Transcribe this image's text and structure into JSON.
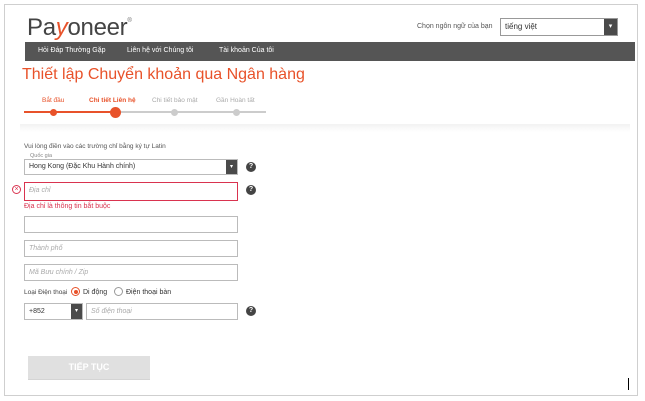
{
  "header": {
    "logo_pre": "Pa",
    "logo_y": "y",
    "logo_post": "oneer",
    "logo_mark": "®",
    "language_label": "Chọn ngôn ngữ của bạn",
    "language_value": "tiếng việt"
  },
  "nav": {
    "items": [
      "Hỏi Đáp Thường Gặp",
      "Liên hệ với Chúng tôi",
      "Tài khoản Của tôi"
    ]
  },
  "page": {
    "title": "Thiết lập Chuyển khoản qua Ngân hàng"
  },
  "steps": {
    "items": [
      "Bắt đầu",
      "Chi tiết Liên hệ",
      "Chi tiết bảo mật",
      "Gần Hoàn tất"
    ],
    "active_index": 1
  },
  "form": {
    "hint": "Vui lòng điền vào các trường chỉ bằng ký tự Latin",
    "country_label": "Quốc gia",
    "country_value": "Hong Kong (Đặc Khu Hành chính)",
    "address_placeholder": "Địa chỉ",
    "address_error": "Địa chỉ là thông tin bắt buộc",
    "address2_value": "",
    "city_placeholder": "Thành phố",
    "zip_placeholder": "Mã Bưu chính / Zip",
    "phone_type_label": "Loại Điện thoại",
    "phone_type_mobile": "Di động",
    "phone_type_landline": "Điện thoại bàn",
    "phone_code": "+852",
    "phone_placeholder": "Số điện thoại",
    "help_glyph": "?",
    "error_glyph": "×",
    "dropdown_glyph": "▾"
  },
  "actions": {
    "continue_label": "TIẾP TỤC"
  },
  "colors": {
    "brand": "#e8522a",
    "error": "#d9334f",
    "nav_bg": "#555555"
  }
}
